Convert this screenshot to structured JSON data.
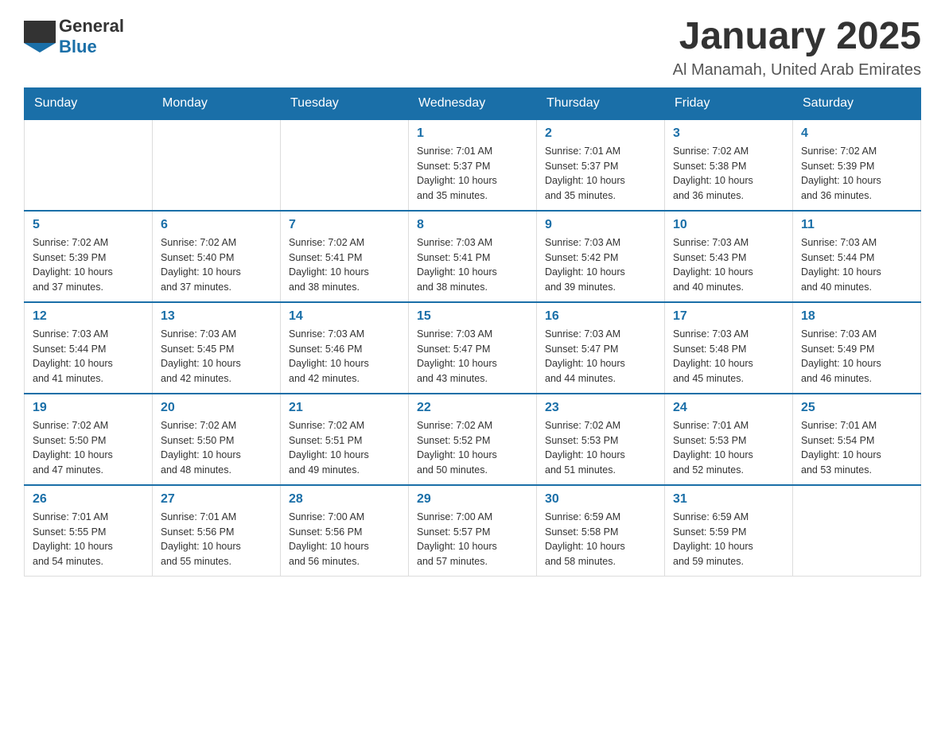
{
  "header": {
    "logo_general": "General",
    "logo_blue": "Blue",
    "month_title": "January 2025",
    "location": "Al Manamah, United Arab Emirates"
  },
  "weekdays": [
    "Sunday",
    "Monday",
    "Tuesday",
    "Wednesday",
    "Thursday",
    "Friday",
    "Saturday"
  ],
  "weeks": [
    [
      {
        "day": "",
        "info": ""
      },
      {
        "day": "",
        "info": ""
      },
      {
        "day": "",
        "info": ""
      },
      {
        "day": "1",
        "info": "Sunrise: 7:01 AM\nSunset: 5:37 PM\nDaylight: 10 hours\nand 35 minutes."
      },
      {
        "day": "2",
        "info": "Sunrise: 7:01 AM\nSunset: 5:37 PM\nDaylight: 10 hours\nand 35 minutes."
      },
      {
        "day": "3",
        "info": "Sunrise: 7:02 AM\nSunset: 5:38 PM\nDaylight: 10 hours\nand 36 minutes."
      },
      {
        "day": "4",
        "info": "Sunrise: 7:02 AM\nSunset: 5:39 PM\nDaylight: 10 hours\nand 36 minutes."
      }
    ],
    [
      {
        "day": "5",
        "info": "Sunrise: 7:02 AM\nSunset: 5:39 PM\nDaylight: 10 hours\nand 37 minutes."
      },
      {
        "day": "6",
        "info": "Sunrise: 7:02 AM\nSunset: 5:40 PM\nDaylight: 10 hours\nand 37 minutes."
      },
      {
        "day": "7",
        "info": "Sunrise: 7:02 AM\nSunset: 5:41 PM\nDaylight: 10 hours\nand 38 minutes."
      },
      {
        "day": "8",
        "info": "Sunrise: 7:03 AM\nSunset: 5:41 PM\nDaylight: 10 hours\nand 38 minutes."
      },
      {
        "day": "9",
        "info": "Sunrise: 7:03 AM\nSunset: 5:42 PM\nDaylight: 10 hours\nand 39 minutes."
      },
      {
        "day": "10",
        "info": "Sunrise: 7:03 AM\nSunset: 5:43 PM\nDaylight: 10 hours\nand 40 minutes."
      },
      {
        "day": "11",
        "info": "Sunrise: 7:03 AM\nSunset: 5:44 PM\nDaylight: 10 hours\nand 40 minutes."
      }
    ],
    [
      {
        "day": "12",
        "info": "Sunrise: 7:03 AM\nSunset: 5:44 PM\nDaylight: 10 hours\nand 41 minutes."
      },
      {
        "day": "13",
        "info": "Sunrise: 7:03 AM\nSunset: 5:45 PM\nDaylight: 10 hours\nand 42 minutes."
      },
      {
        "day": "14",
        "info": "Sunrise: 7:03 AM\nSunset: 5:46 PM\nDaylight: 10 hours\nand 42 minutes."
      },
      {
        "day": "15",
        "info": "Sunrise: 7:03 AM\nSunset: 5:47 PM\nDaylight: 10 hours\nand 43 minutes."
      },
      {
        "day": "16",
        "info": "Sunrise: 7:03 AM\nSunset: 5:47 PM\nDaylight: 10 hours\nand 44 minutes."
      },
      {
        "day": "17",
        "info": "Sunrise: 7:03 AM\nSunset: 5:48 PM\nDaylight: 10 hours\nand 45 minutes."
      },
      {
        "day": "18",
        "info": "Sunrise: 7:03 AM\nSunset: 5:49 PM\nDaylight: 10 hours\nand 46 minutes."
      }
    ],
    [
      {
        "day": "19",
        "info": "Sunrise: 7:02 AM\nSunset: 5:50 PM\nDaylight: 10 hours\nand 47 minutes."
      },
      {
        "day": "20",
        "info": "Sunrise: 7:02 AM\nSunset: 5:50 PM\nDaylight: 10 hours\nand 48 minutes."
      },
      {
        "day": "21",
        "info": "Sunrise: 7:02 AM\nSunset: 5:51 PM\nDaylight: 10 hours\nand 49 minutes."
      },
      {
        "day": "22",
        "info": "Sunrise: 7:02 AM\nSunset: 5:52 PM\nDaylight: 10 hours\nand 50 minutes."
      },
      {
        "day": "23",
        "info": "Sunrise: 7:02 AM\nSunset: 5:53 PM\nDaylight: 10 hours\nand 51 minutes."
      },
      {
        "day": "24",
        "info": "Sunrise: 7:01 AM\nSunset: 5:53 PM\nDaylight: 10 hours\nand 52 minutes."
      },
      {
        "day": "25",
        "info": "Sunrise: 7:01 AM\nSunset: 5:54 PM\nDaylight: 10 hours\nand 53 minutes."
      }
    ],
    [
      {
        "day": "26",
        "info": "Sunrise: 7:01 AM\nSunset: 5:55 PM\nDaylight: 10 hours\nand 54 minutes."
      },
      {
        "day": "27",
        "info": "Sunrise: 7:01 AM\nSunset: 5:56 PM\nDaylight: 10 hours\nand 55 minutes."
      },
      {
        "day": "28",
        "info": "Sunrise: 7:00 AM\nSunset: 5:56 PM\nDaylight: 10 hours\nand 56 minutes."
      },
      {
        "day": "29",
        "info": "Sunrise: 7:00 AM\nSunset: 5:57 PM\nDaylight: 10 hours\nand 57 minutes."
      },
      {
        "day": "30",
        "info": "Sunrise: 6:59 AM\nSunset: 5:58 PM\nDaylight: 10 hours\nand 58 minutes."
      },
      {
        "day": "31",
        "info": "Sunrise: 6:59 AM\nSunset: 5:59 PM\nDaylight: 10 hours\nand 59 minutes."
      },
      {
        "day": "",
        "info": ""
      }
    ]
  ]
}
